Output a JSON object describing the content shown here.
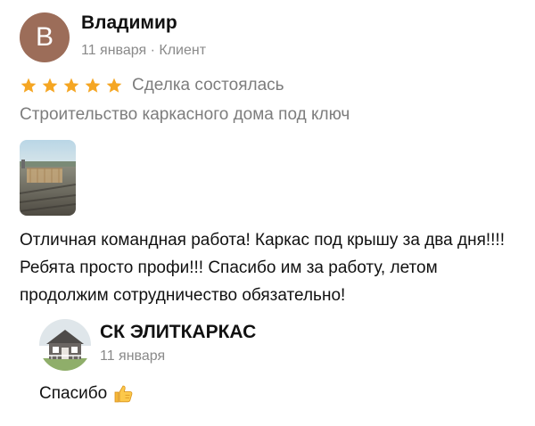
{
  "review": {
    "avatar_letter": "В",
    "author_name": "Владимир",
    "meta": "11 января · Клиент",
    "rating": 5,
    "deal_status": "Сделка состоялась",
    "service": "Строительство каркасного дома под ключ",
    "text": "Отличная командная работа! Каркас под крышу за два дня!!!! Ребята просто профи!!! Спасибо им за работу, летом продолжим сотрудничество обязательно!"
  },
  "response": {
    "company_name": "СК ЭЛИТКАРКАС",
    "date": "11 января",
    "text": "Спасибо"
  },
  "colors": {
    "avatar_bg": "#9c6d59",
    "star": "#f5a623",
    "secondary_text": "#7d7d7d"
  },
  "icons": {
    "star": "star-icon",
    "reply_emoji": "thumbs-up-icon"
  }
}
